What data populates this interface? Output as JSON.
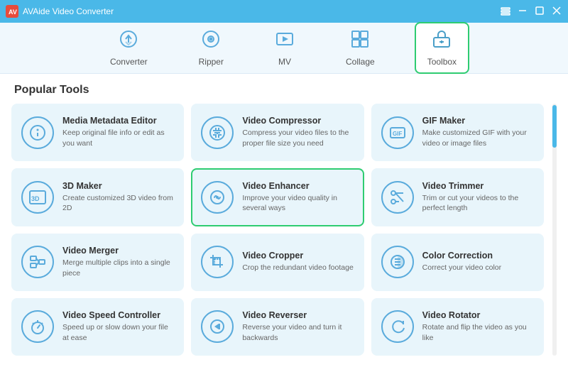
{
  "titleBar": {
    "appName": "AVAide Video Converter",
    "logoText": "AV"
  },
  "nav": {
    "items": [
      {
        "id": "converter",
        "label": "Converter",
        "active": false
      },
      {
        "id": "ripper",
        "label": "Ripper",
        "active": false
      },
      {
        "id": "mv",
        "label": "MV",
        "active": false
      },
      {
        "id": "collage",
        "label": "Collage",
        "active": false
      },
      {
        "id": "toolbox",
        "label": "Toolbox",
        "active": true
      }
    ]
  },
  "mainSection": {
    "title": "Popular Tools"
  },
  "tools": [
    {
      "id": "media-metadata-editor",
      "name": "Media Metadata Editor",
      "desc": "Keep original file info or edit as you want",
      "icon": "info",
      "selected": false
    },
    {
      "id": "video-compressor",
      "name": "Video Compressor",
      "desc": "Compress your video files to the proper file size you need",
      "icon": "compress",
      "selected": false
    },
    {
      "id": "gif-maker",
      "name": "GIF Maker",
      "desc": "Make customized GIF with your video or image files",
      "icon": "gif",
      "selected": false
    },
    {
      "id": "3d-maker",
      "name": "3D Maker",
      "desc": "Create customized 3D video from 2D",
      "icon": "3d",
      "selected": false
    },
    {
      "id": "video-enhancer",
      "name": "Video Enhancer",
      "desc": "Improve your video quality in several ways",
      "icon": "enhance",
      "selected": true
    },
    {
      "id": "video-trimmer",
      "name": "Video Trimmer",
      "desc": "Trim or cut your videos to the perfect length",
      "icon": "trim",
      "selected": false
    },
    {
      "id": "video-merger",
      "name": "Video Merger",
      "desc": "Merge multiple clips into a single piece",
      "icon": "merge",
      "selected": false
    },
    {
      "id": "video-cropper",
      "name": "Video Cropper",
      "desc": "Crop the redundant video footage",
      "icon": "crop",
      "selected": false
    },
    {
      "id": "color-correction",
      "name": "Color Correction",
      "desc": "Correct your video color",
      "icon": "color",
      "selected": false
    },
    {
      "id": "video-speed-controller",
      "name": "Video Speed Controller",
      "desc": "Speed up or slow down your file at ease",
      "icon": "speed",
      "selected": false
    },
    {
      "id": "video-reverser",
      "name": "Video Reverser",
      "desc": "Reverse your video and turn it backwards",
      "icon": "reverse",
      "selected": false
    },
    {
      "id": "video-rotator",
      "name": "Video Rotator",
      "desc": "Rotate and flip the video as you like",
      "icon": "rotate",
      "selected": false
    }
  ]
}
